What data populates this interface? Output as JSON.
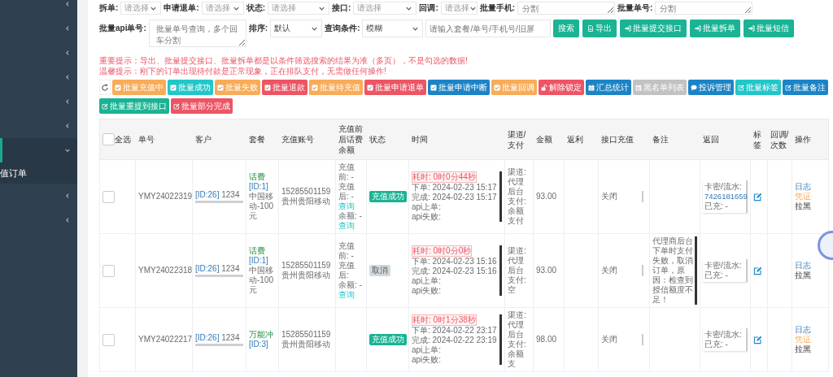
{
  "sidebar": {
    "items": [
      {
        "expanded": false
      },
      {
        "expanded": false
      },
      {
        "expanded": false
      },
      {
        "expanded": false
      },
      {
        "expanded": false
      },
      {
        "expanded": false
      },
      {
        "expanded": true,
        "children": [
          {
            "label": "值订单",
            "selected": true
          }
        ]
      },
      {
        "expanded": false
      },
      {
        "expanded": false
      }
    ]
  },
  "filters": [
    {
      "label": "拆单:",
      "kind": "select",
      "placeholder": "请选择"
    },
    {
      "label": "申请退单:",
      "kind": "select",
      "placeholder": "请选择"
    },
    {
      "label": "状态:",
      "kind": "select",
      "placeholder": "请选择"
    },
    {
      "label": "接口:",
      "kind": "select",
      "placeholder": "请选择"
    },
    {
      "label": "回调:",
      "kind": "select",
      "placeholder": "请选择"
    },
    {
      "label": "批量手机:",
      "kind": "textarea",
      "placeholder": "分割"
    },
    {
      "label": "批量单号:",
      "kind": "textarea",
      "placeholder": "分割"
    }
  ],
  "search_row": [
    {
      "label": "批量api单号:",
      "kind": "textarea",
      "placeholder": "批量单号查询，多个回车分割"
    },
    {
      "label": "排序:",
      "kind": "select",
      "value": "默认"
    },
    {
      "label": "查询条件:",
      "kind": "select",
      "value": "模糊"
    },
    {
      "kind": "input",
      "placeholder": "请输入套餐/单号/手机号/旧屏"
    }
  ],
  "search_buttons": [
    {
      "label": "搜索"
    },
    {
      "label": "导出"
    },
    {
      "label": "批量提交接口"
    },
    {
      "label": "批量拆单"
    },
    {
      "label": "批量短信"
    }
  ],
  "notices": [
    "重要提示：导出、批量提交接口、批量拆单都是以条件筛选搜索的结果为准（多页），不是勾选的数据!",
    "温馨提示：刚下的订单出现待付款是正常现象，正在排队支付，无需做任何操作!"
  ],
  "action_rows": [
    [
      {
        "label": "批量充值中"
      },
      {
        "label": "批量成功"
      },
      {
        "label": "批量失败"
      },
      {
        "label": "批量退款"
      },
      {
        "label": "批量待充值"
      },
      {
        "label": "批量申请退单"
      },
      {
        "label": "批量申请中断"
      },
      {
        "label": "批量回调"
      },
      {
        "label": "解除锁定"
      },
      {
        "label": "汇总统计"
      },
      {
        "label": "黑名单列表"
      },
      {
        "label": "投诉管理"
      },
      {
        "label": "批量标签"
      },
      {
        "label": "批量备注"
      }
    ],
    [
      {
        "label": "批量重提到接口"
      },
      {
        "label": "批量部分完成"
      }
    ]
  ],
  "table": {
    "select_all": {
      "label": "全选",
      "checked": false
    },
    "columns": [
      "单号",
      "客户",
      "套餐",
      "充值账号",
      "充值前后话费余额",
      "状态",
      "时间",
      "渠道/支付",
      "金额",
      "返利",
      "接口充值",
      "备注",
      "返回",
      "标签",
      "回调/次数",
      "操作"
    ],
    "rows": [
      {
        "checked": false,
        "order_no": "YMY24022319",
        "customer": {
          "id": "[ID:26]",
          "name": "1234"
        },
        "package": {
          "type": "话费",
          "id": "[ID:1]",
          "name": "中国移动-100元"
        },
        "account": {
          "number": "15285501159",
          "region": "贵州贵阳移动"
        },
        "balance": [
          {
            "kind": "text",
            "text": "充值前: -"
          },
          {
            "kind": "text",
            "text": "充值后: -"
          },
          {
            "kind": "link",
            "text": "查询"
          },
          {
            "kind": "text",
            "text": "余额: -"
          },
          {
            "kind": "link",
            "text": "查询"
          }
        ],
        "status": {
          "text": "充值成功",
          "kind": "success"
        },
        "time": {
          "duration": "耗时: 0时0分44秒",
          "lines": [
            "下单: 2024-02-23 15:17",
            "完成: 2024-02-23 15:17",
            "api上单:",
            "api失败:"
          ]
        },
        "channel": [
          "渠道: 代理后台",
          "支付: 余额支付"
        ],
        "amount": "93.00",
        "interface": "关闭",
        "return": {
          "label": "卡密/流水:",
          "serial": "7426181659",
          "charged": "已充: -"
        },
        "actions": [
          {
            "text": "日志",
            "kind": "log"
          },
          {
            "text": "凭证",
            "kind": "voucher"
          },
          {
            "text": "拉黑",
            "kind": "block"
          }
        ]
      },
      {
        "checked": false,
        "order_no": "YMY24022318",
        "customer": {
          "id": "[ID:26]",
          "name": "1234"
        },
        "package": {
          "type": "话费",
          "id": "[ID:1]",
          "name": "中国移动-100元"
        },
        "account": {
          "number": "15285501159",
          "region": "贵州贵阳移动"
        },
        "balance": [
          {
            "kind": "text",
            "text": "充值前: -"
          },
          {
            "kind": "text",
            "text": "充值后:"
          },
          {
            "kind": "text",
            "text": "余额: -"
          },
          {
            "kind": "link",
            "text": "查询"
          }
        ],
        "status": {
          "text": "取消",
          "kind": "cancel"
        },
        "time": {
          "duration": "耗时: 0时0分0秒",
          "lines": [
            "下单: 2024-02-23 15:16",
            "完成: 2024-02-23 15:16",
            "api上单:",
            "api失败:"
          ]
        },
        "channel": [
          "渠道: 代理后台",
          "支付: 空"
        ],
        "amount": "93.00",
        "interface": "关闭",
        "remark": "代理商后台下单时支付失败，取消订单，原因：检查到授信额度不足！",
        "return": {
          "label": "卡密/流水:",
          "charged": "已充: -"
        },
        "actions": [
          {
            "text": "日志",
            "kind": "log"
          },
          {
            "text": "拉黑",
            "kind": "block"
          }
        ]
      },
      {
        "checked": false,
        "order_no": "YMY24022217",
        "customer": {
          "id": "[ID:26]",
          "name": "1234"
        },
        "package": {
          "type": "万能冲",
          "id": "[ID:3]"
        },
        "account": {
          "number": "15285501159",
          "region": "贵州贵阳移动"
        },
        "balance": [],
        "status": {
          "text": "充值成功",
          "kind": "success"
        },
        "time": {
          "duration": "耗时: 0时1分38秒",
          "lines": [
            "下单: 2024-02-22 23:17",
            "完成: 2024-02-22 23:19",
            "api上单:",
            "api失败:"
          ]
        },
        "channel": [
          "渠道: 代理后台",
          "支付: 余额支"
        ],
        "amount": "98.00",
        "interface": "关闭",
        "return": {
          "label": "卡密/流水:",
          "charged": "已充: -"
        },
        "actions": [
          {
            "text": "日志",
            "kind": "log"
          },
          {
            "text": "凭证",
            "kind": "voucher"
          },
          {
            "text": "拉黑",
            "kind": "block"
          }
        ]
      }
    ]
  }
}
